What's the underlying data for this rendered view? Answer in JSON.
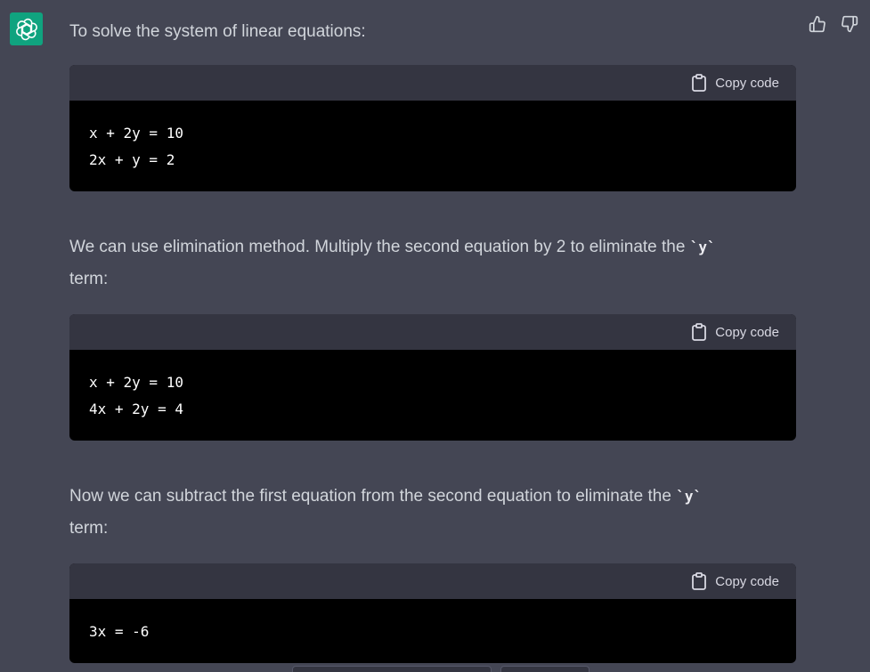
{
  "colors": {
    "background": "#444654",
    "avatar": "#10a37f",
    "code_header": "#343541",
    "code_body": "#000000"
  },
  "avatar": {
    "icon": "openai-logo-icon"
  },
  "feedback": {
    "thumbs_up_icon": "thumbs-up-icon",
    "thumbs_down_icon": "thumbs-down-icon"
  },
  "message": {
    "intro": "To solve the system of linear equations:",
    "blocks": [
      {
        "copy_label": "Copy code",
        "code": "x + 2y = 10\n2x + y = 2"
      },
      {
        "copy_label": "Copy code",
        "code": "x + 2y = 10\n4x + 2y = 4"
      },
      {
        "copy_label": "Copy code",
        "code": "3x = -6"
      }
    ],
    "para2_text": "We can use elimination method. Multiply the second equation by 2 to eliminate the ",
    "para2_code": "`y`",
    "para2_end": "term:",
    "para3_text": "Now we can subtract the first equation from the second equation to eliminate the ",
    "para3_code": "`y`",
    "para3_end": "term:"
  }
}
